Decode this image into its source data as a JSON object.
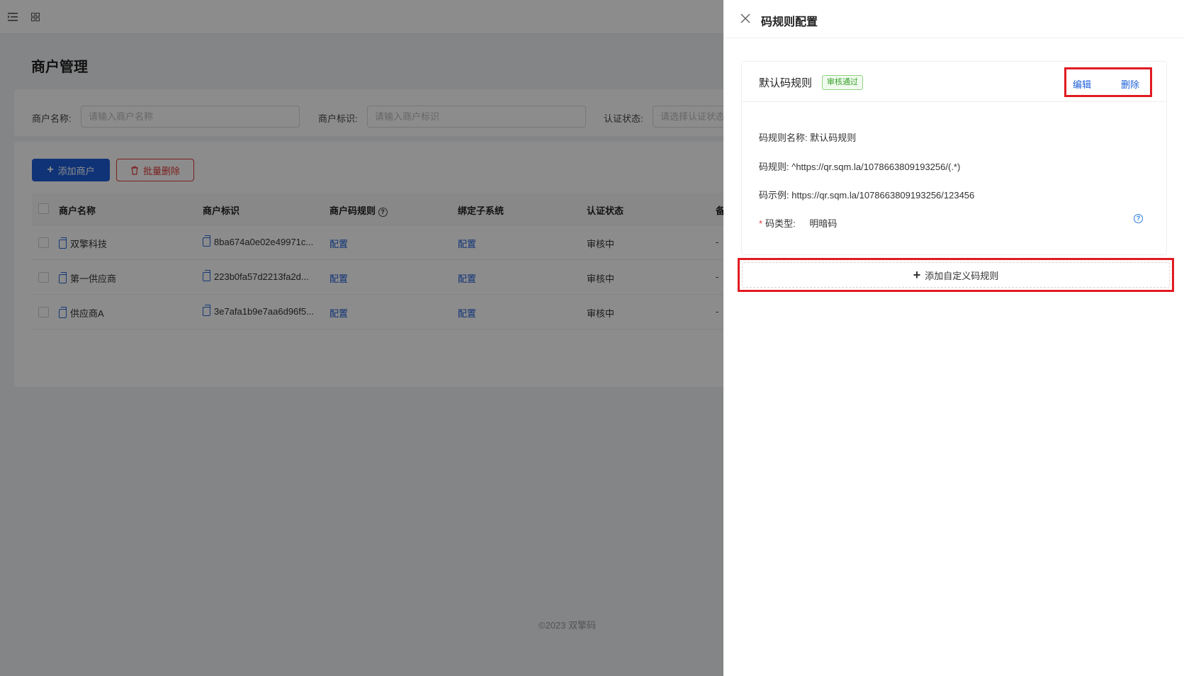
{
  "base": {
    "page_title": "商户管理",
    "search": [
      {
        "label": "商户名称:",
        "placeholder": "请输入商户名称"
      },
      {
        "label": "商户标识:",
        "placeholder": "请输入商户标识"
      },
      {
        "label": "认证状态:",
        "placeholder": "请选择认证状态"
      }
    ],
    "add_button": "添加商户",
    "batch_delete_button": "批量删除",
    "columns": [
      "商户名称",
      "商户标识",
      "商户码规则",
      "绑定子系统",
      "认证状态",
      "备注"
    ],
    "rows": [
      {
        "name": "双擎科技",
        "id": "8ba674a0e02e49971c...",
        "rule": "配置",
        "subsystem": "配置",
        "status": "审核中",
        "note": "-"
      },
      {
        "name": "第一供应商",
        "id": "223b0fa57d2213fa2d...",
        "rule": "配置",
        "subsystem": "配置",
        "status": "审核中",
        "note": "-"
      },
      {
        "name": "供应商A",
        "id": "3e7afa1b9e7aa6d96f5...",
        "rule": "配置",
        "subsystem": "配置",
        "status": "审核中",
        "note": "-"
      }
    ],
    "footer": "©2023 双擎码"
  },
  "drawer": {
    "title": "码规则配置",
    "rule": {
      "name": "默认码规则",
      "badge": "审核通过",
      "edit": "编辑",
      "delete": "删除",
      "name_line": "码规则名称: 默认码规则",
      "rule_line": "码规则: ^https://qr.sqm.la/1078663809193256/(.*)",
      "example_line": "码示例: https://qr.sqm.la/1078663809193256/123456",
      "type_label": "码类型:",
      "type_value": "明暗码"
    },
    "add_custom": "添加自定义码规则"
  },
  "colors": {
    "primary": "#1d5ed8",
    "danger": "#e23b3b",
    "success": "#37a32a",
    "highlight": "#e11b22"
  }
}
